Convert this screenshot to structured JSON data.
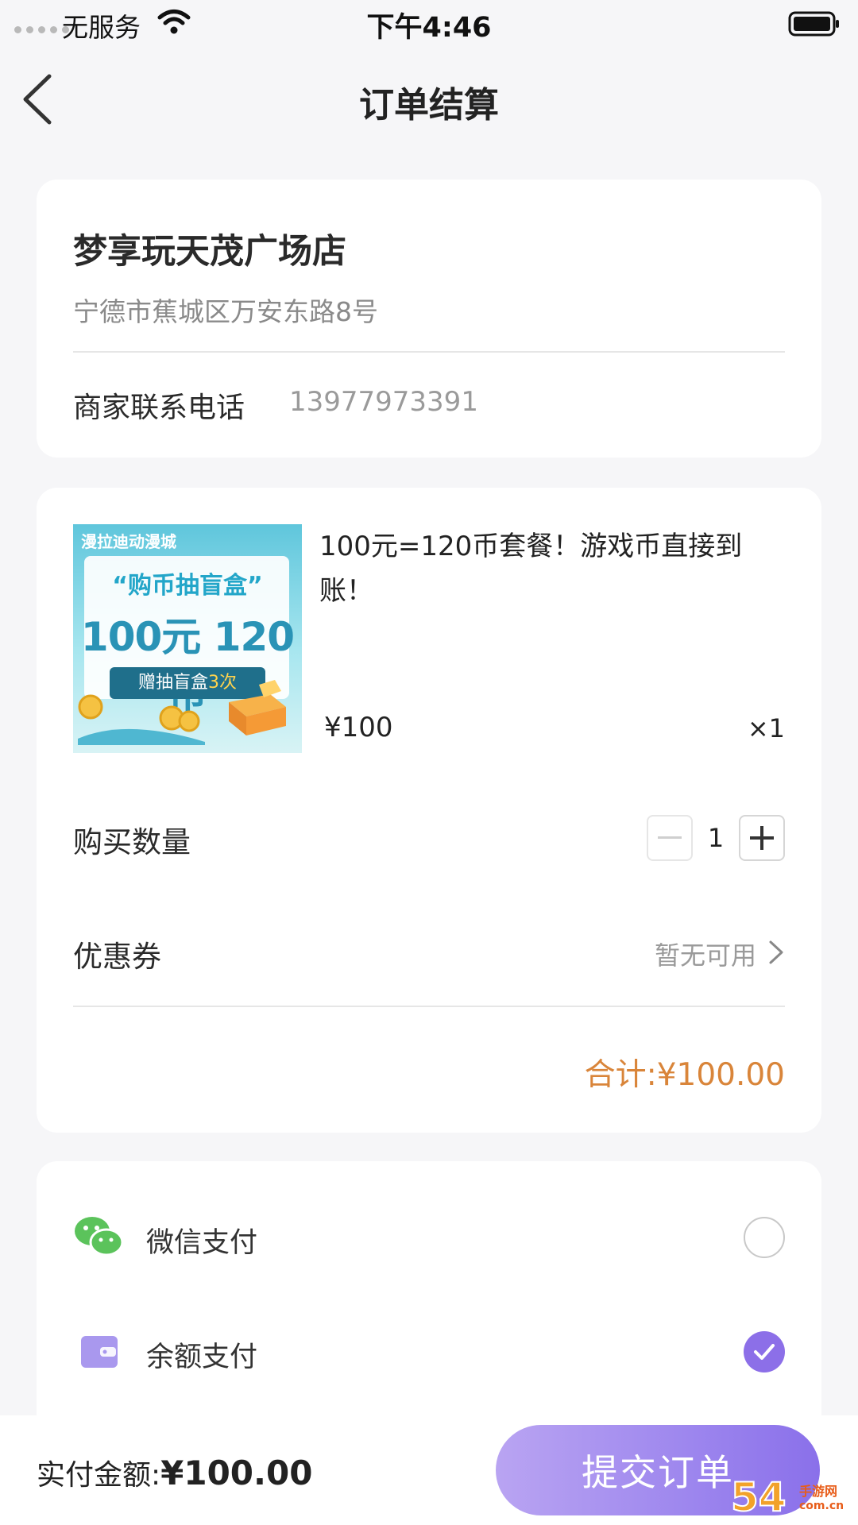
{
  "status_bar": {
    "carrier": "无服务",
    "time": "下午4:46"
  },
  "nav": {
    "title": "订单结算"
  },
  "store": {
    "name": "梦享玩天茂广场店",
    "address": "宁德市蕉城区万安东路8号",
    "phone_label": "商家联系电话",
    "phone": "13977973391"
  },
  "product": {
    "image": {
      "banner": "漫拉迪动漫城",
      "line1": "“购币抽盲盒”",
      "line2": "100元 120币",
      "tag_prefix": "赠抽盲盒",
      "tag_highlight": "3次"
    },
    "title": "100元=120币套餐！游戏币直接到账！",
    "price": "¥100",
    "quantity": "×1"
  },
  "quantity_row": {
    "label": "购买数量",
    "value": "1"
  },
  "coupon": {
    "label": "优惠券",
    "value": "暂无可用"
  },
  "total": "合计:¥100.00",
  "payment": {
    "methods": [
      {
        "label": "微信支付",
        "icon": "wechat-icon",
        "selected": false
      },
      {
        "label": "余额支付",
        "icon": "wallet-icon",
        "selected": true
      }
    ]
  },
  "bottom": {
    "pay_label": "实付金额:",
    "pay_amount": "¥100.00",
    "submit_label": "提交订单"
  },
  "watermark": {
    "big": "54",
    "small": "手游网",
    "domain": "com.cn"
  },
  "colors": {
    "accent": "#8c6fe8",
    "total": "#d9853a",
    "wechat_green": "#5bc35b"
  }
}
